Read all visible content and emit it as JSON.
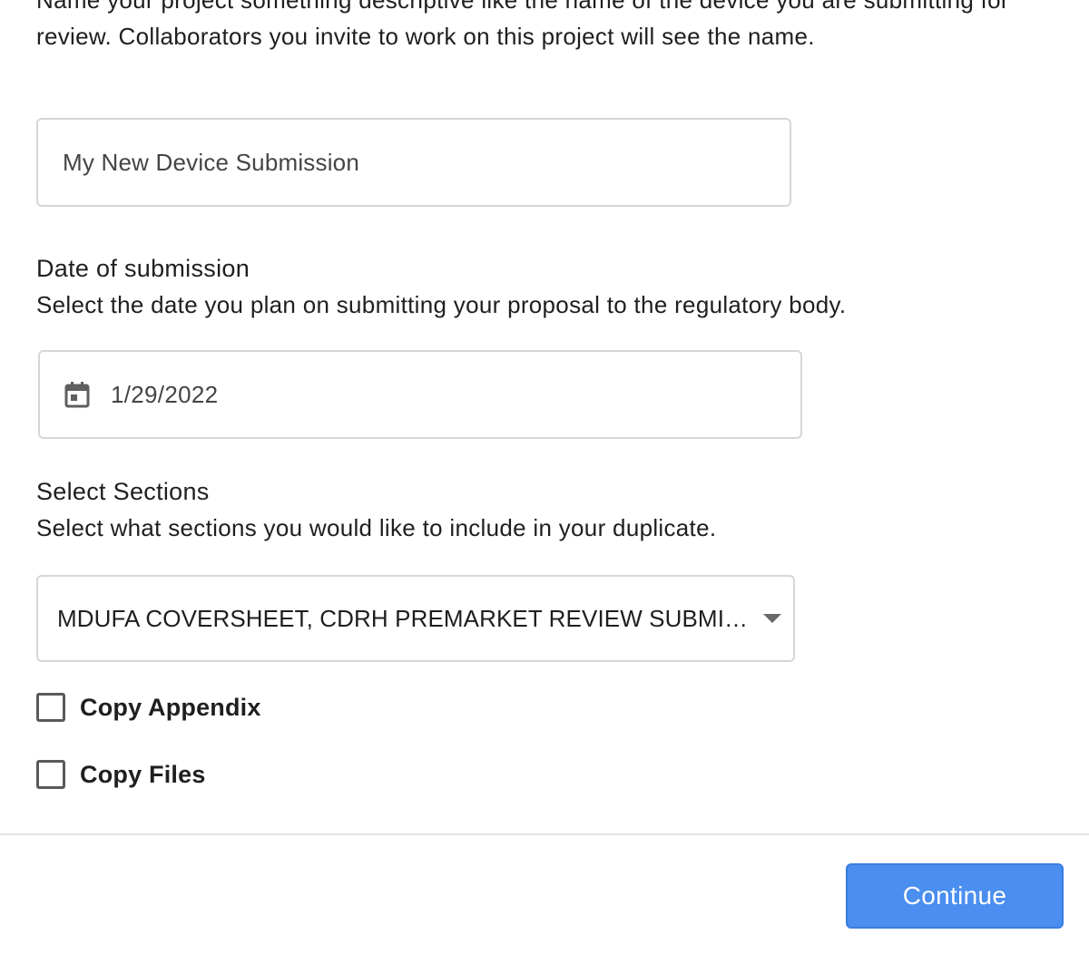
{
  "project_name": {
    "description": "Name your project something descriptive like the name of the device you are submitting for review. Collaborators you invite to work on this project will see the name.",
    "value": "My New Device Submission"
  },
  "submission_date": {
    "title": "Date of submission",
    "description": "Select the date you plan on submitting your proposal to the regulatory body.",
    "value": "1/29/2022",
    "icon": "calendar-icon"
  },
  "sections": {
    "title": "Select Sections",
    "description": "Select what sections you would like to include in your duplicate.",
    "selected_value": "MDUFA COVERSHEET, CDRH PREMARKET REVIEW SUBMISSION COVER SHEET",
    "icon": "chevron-down-icon"
  },
  "options": {
    "copy_appendix": {
      "label": "Copy Appendix",
      "checked": false
    },
    "copy_files": {
      "label": "Copy Files",
      "checked": false
    }
  },
  "footer": {
    "continue_label": "Continue",
    "accent_color": "#4a8ef0"
  }
}
